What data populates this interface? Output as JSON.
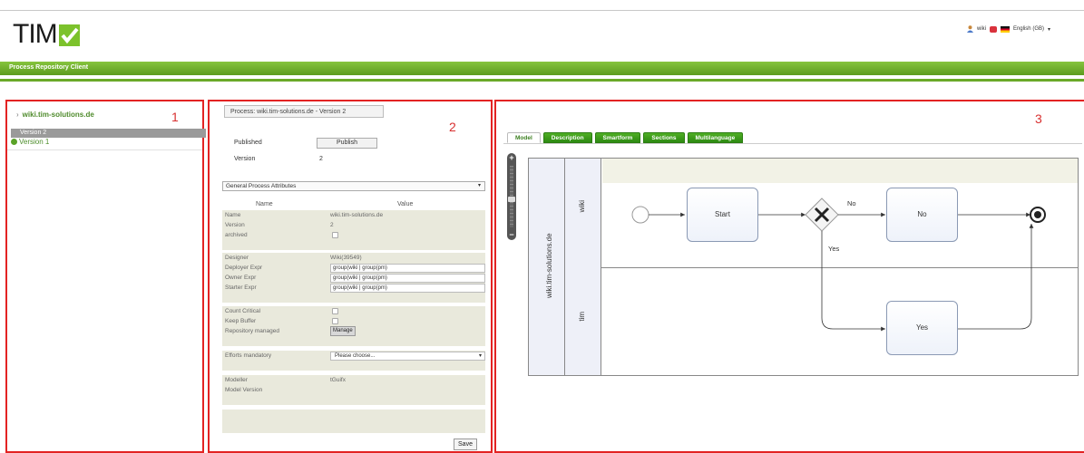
{
  "header": {
    "logo_text": "TIM",
    "user_name": "wiki",
    "language": "English (GB)",
    "language_arrow": "▾"
  },
  "nav": {
    "title": "Process Repository Client"
  },
  "panels": {
    "p1_number": "1",
    "p2_number": "2",
    "p3_number": "3"
  },
  "tree": {
    "root": "wiki.tim-solutions.de",
    "root_bullet": "›",
    "versions": [
      "Version 2",
      "Version 1"
    ]
  },
  "process": {
    "header": "Process: wiki.tim-solutions.de - Version 2",
    "published_label": "Published",
    "publish_button": "Publish",
    "version_label": "Version",
    "version_value": "2",
    "attributes_select": "General Process Attributes",
    "select_arrow": "▾",
    "col_name": "Name",
    "col_value": "Value",
    "rows": {
      "name": {
        "label": "Name",
        "value": "wiki.tim-solutions.de"
      },
      "version": {
        "label": "Version",
        "value": "2"
      },
      "archived": {
        "label": "archived"
      },
      "designer": {
        "label": "Designer",
        "value": "Wiki(39549)"
      },
      "deployer": {
        "label": "Deployer Expr",
        "value": "group(wiki | group(pm)"
      },
      "owner": {
        "label": "Owner Expr",
        "value": "group(wiki | group(pm)"
      },
      "starter": {
        "label": "Starter Expr",
        "value": "group(wiki | group(pm)"
      },
      "count_critical": {
        "label": "Count Critical"
      },
      "keep_buffer": {
        "label": "Keep Buffer"
      },
      "repo_managed": {
        "label": "Repository managed",
        "value": "Manage"
      },
      "efforts": {
        "label": "Efforts mandatory",
        "value": "Please choose..."
      },
      "modeller": {
        "label": "Modeller",
        "value": "tGuifx"
      },
      "model_version": {
        "label": "Model Version"
      }
    },
    "save_button": "Save"
  },
  "model": {
    "tabs": [
      "Model",
      "Description",
      "Smartform",
      "Sections",
      "Multilanguage"
    ],
    "zoom_plus": "+",
    "zoom_minus": "−",
    "pool": "wiki.tim-solutions.de",
    "lanes": [
      "wiki",
      "tim"
    ],
    "tasks": {
      "start": "Start",
      "no": "No",
      "yes": "Yes"
    },
    "gateway_labels": {
      "no": "No",
      "yes": "Yes"
    }
  },
  "colors": {
    "accent_green": "#5c9b1e",
    "highlight_red": "#e32323"
  }
}
